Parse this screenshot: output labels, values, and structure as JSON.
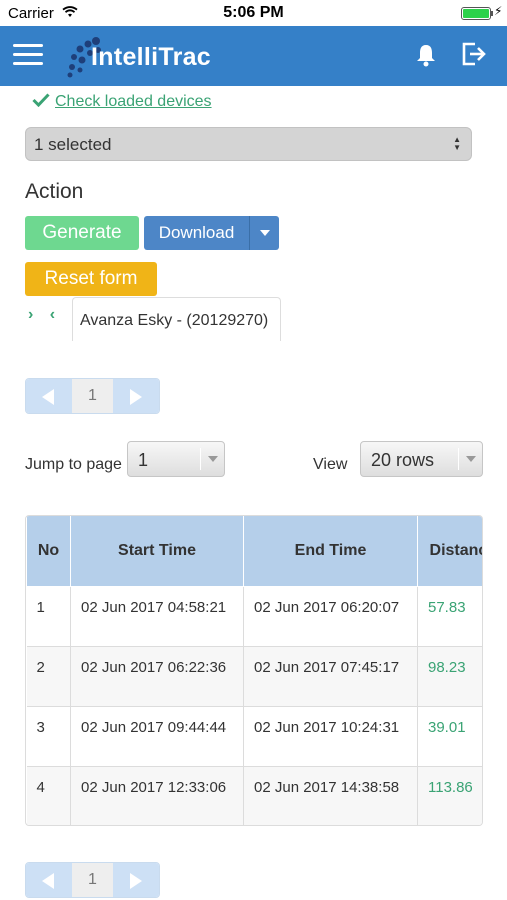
{
  "status_bar": {
    "carrier": "Carrier",
    "time": "5:06 PM"
  },
  "header": {
    "app_name": "IntelliTrac"
  },
  "devices": {
    "check_link": "Check loaded devices",
    "select_value": "1 selected"
  },
  "action": {
    "title": "Action",
    "generate_label": "Generate",
    "download_label": "Download",
    "reset_label": "Reset form"
  },
  "expand": {
    "expand_collapse": "› ‹"
  },
  "selected_device": {
    "tag": "Avanza Esky - (20129270)"
  },
  "pagination": {
    "current_page": "1"
  },
  "controls": {
    "jump_label": "Jump to page",
    "jump_value": "1",
    "view_label": "View",
    "view_value": "20 rows"
  },
  "table": {
    "headers": {
      "no": "No",
      "start": "Start Time",
      "end": "End Time",
      "distance": "Distance (km)"
    },
    "rows": [
      {
        "no": "1",
        "start": "02 Jun 2017 04:58:21",
        "end": "02 Jun 2017 06:20:07",
        "distance": "57.83"
      },
      {
        "no": "2",
        "start": "02 Jun 2017 06:22:36",
        "end": "02 Jun 2017 07:45:17",
        "distance": "98.23"
      },
      {
        "no": "3",
        "start": "02 Jun 2017 09:44:44",
        "end": "02 Jun 2017 10:24:31",
        "distance": "39.01"
      },
      {
        "no": "4",
        "start": "02 Jun 2017 12:33:06",
        "end": "02 Jun 2017 14:38:58",
        "distance": "113.86"
      }
    ]
  },
  "colors": {
    "header_bg": "#3580c8",
    "accent_green": "#3aa374",
    "generate_bg": "#6ed890",
    "download_bg": "#4d86c7",
    "reset_bg": "#f0b417",
    "table_header_bg": "#b5cfea"
  }
}
